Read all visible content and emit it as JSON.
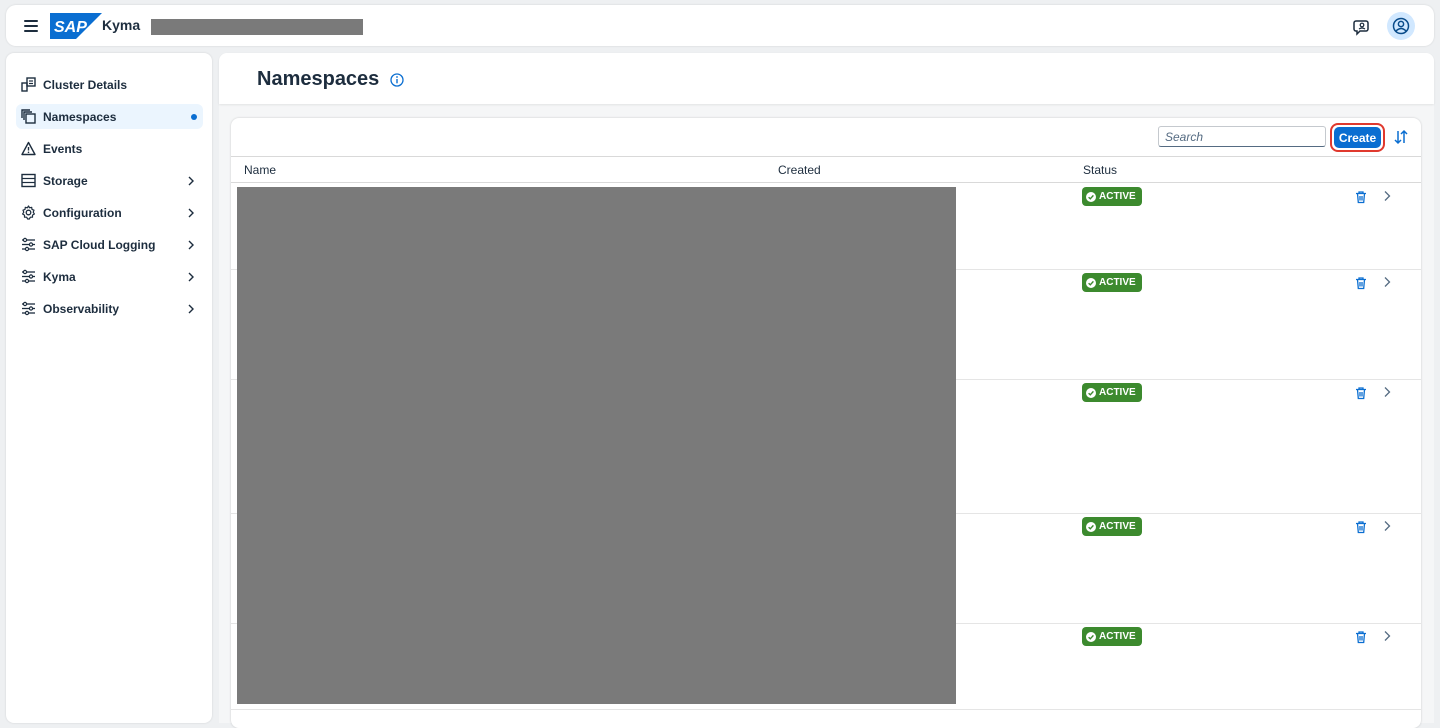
{
  "shellbar": {
    "logo_text": "SAP",
    "product": "Kyma",
    "icons": [
      "menu-icon",
      "feedback-icon",
      "user-avatar-icon"
    ]
  },
  "sidebar": {
    "items": [
      {
        "label": "Cluster Details",
        "icon": "cluster-details-icon",
        "expandable": false,
        "selected": false
      },
      {
        "label": "Namespaces",
        "icon": "namespaces-icon",
        "expandable": false,
        "selected": true
      },
      {
        "label": "Events",
        "icon": "warning-icon",
        "expandable": false,
        "selected": false
      },
      {
        "label": "Storage",
        "icon": "storage-icon",
        "expandable": true,
        "selected": false
      },
      {
        "label": "Configuration",
        "icon": "gear-icon",
        "expandable": true,
        "selected": false
      },
      {
        "label": "SAP Cloud Logging",
        "icon": "filter-sliders-icon",
        "expandable": true,
        "selected": false
      },
      {
        "label": "Kyma",
        "icon": "filter-sliders-icon",
        "expandable": true,
        "selected": false
      },
      {
        "label": "Observability",
        "icon": "filter-sliders-icon",
        "expandable": true,
        "selected": false
      }
    ]
  },
  "page": {
    "title": "Namespaces"
  },
  "toolbar": {
    "search_placeholder": "Search",
    "create_label": "Create"
  },
  "table": {
    "columns": [
      "Name",
      "Created",
      "Status"
    ],
    "rows": [
      {
        "status": "ACTIVE"
      },
      {
        "status": "ACTIVE"
      },
      {
        "status": "ACTIVE"
      },
      {
        "status": "ACTIVE"
      },
      {
        "status": "ACTIVE"
      }
    ]
  },
  "colors": {
    "accent": "#0a6ed1",
    "status_active": "#3c8a2e",
    "highlight_ring": "#e0392e",
    "redaction": "#7a7a7a"
  }
}
